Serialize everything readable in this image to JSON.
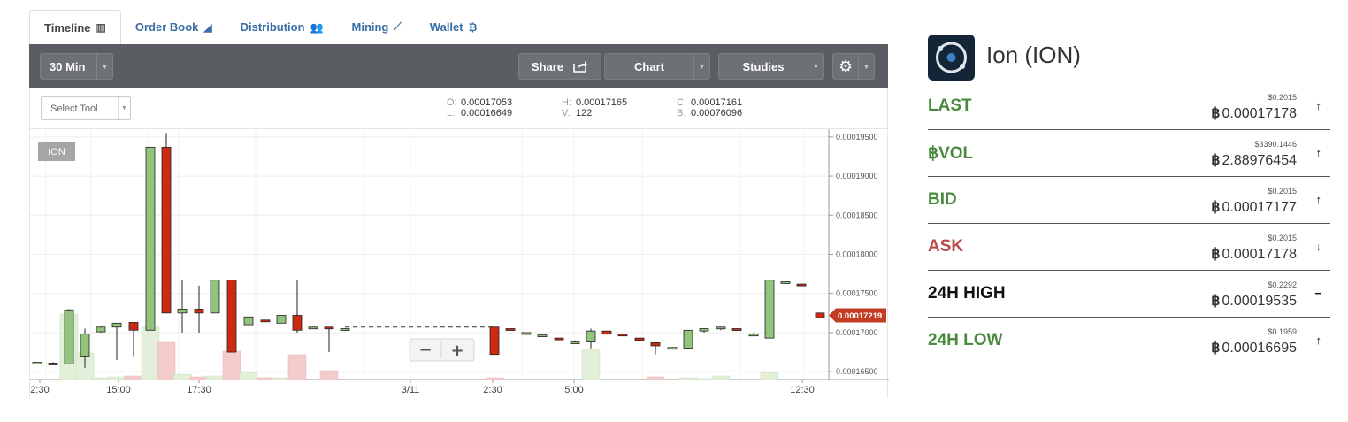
{
  "tabs": [
    {
      "label": "Timeline",
      "icon": "bar-chart-icon",
      "glyph": "▥"
    },
    {
      "label": "Order Book",
      "icon": "area-chart-icon",
      "glyph": "◢"
    },
    {
      "label": "Distribution",
      "icon": "users-icon",
      "glyph": "👥"
    },
    {
      "label": "Mining",
      "icon": "line-chart-icon",
      "glyph": "⟋"
    },
    {
      "label": "Wallet",
      "icon": "bitcoin-icon",
      "glyph": "₿"
    }
  ],
  "toolbar": {
    "interval": "30 Min",
    "share": "Share",
    "chart": "Chart",
    "studies": "Studies",
    "settings_icon": "⚙"
  },
  "tool_select": "Select Tool",
  "ohlc": {
    "o": "0.00017053",
    "h": "0.00017165",
    "c": "0.00017161",
    "l": "0.00016649",
    "v": "122",
    "b": "0.00076096",
    "o_key": "O:",
    "h_key": "H:",
    "c_key": "C:",
    "l_key": "L:",
    "v_key": "V:",
    "b_key": "B:"
  },
  "chart_data": {
    "type": "candlestick",
    "symbol_label": "ION",
    "current_price_label": "0.00017219",
    "y_ticks": [
      "0.00019500",
      "0.00019000",
      "0.00018500",
      "0.00018000",
      "0.00017500",
      "0.00017000",
      "0.00016500"
    ],
    "ylim": [
      0.000164,
      0.000196
    ],
    "x_ticks": [
      "2:30",
      "15:00",
      "17:30",
      "3/11",
      "2:30",
      "5:00",
      "12:30"
    ],
    "colors": {
      "up": "#93c47d",
      "down": "#cc2b12",
      "up_vol": "#e2f0d9",
      "down_vol": "#f4cccc",
      "last_price": "#c23b22"
    },
    "zoom_out": "−",
    "zoom_in": "+"
  },
  "coin": {
    "name": "Ion (ION)",
    "logo": "ion-logo"
  },
  "stats": [
    {
      "label": "LAST",
      "usd": "$0.2015",
      "btc": "0.00017178",
      "arrow": "↑",
      "color": "green",
      "arrow_color": "dark"
    },
    {
      "label": "฿VOL",
      "usd": "$3390.1446",
      "btc": "2.88976454",
      "arrow": "↑",
      "color": "green",
      "arrow_color": "dark"
    },
    {
      "label": "BID",
      "usd": "$0.2015",
      "btc": "0.00017177",
      "arrow": "↑",
      "color": "green",
      "arrow_color": "dark"
    },
    {
      "label": "ASK",
      "usd": "$0.2015",
      "btc": "0.00017178",
      "arrow": "↓",
      "color": "red",
      "arrow_color": "red"
    },
    {
      "label": "24H HIGH",
      "usd": "$0.2292",
      "btc": "0.00019535",
      "arrow": "−",
      "color": "dark",
      "arrow_color": "dark"
    },
    {
      "label": "24H LOW",
      "usd": "$0.1959",
      "btc": "0.00016695",
      "arrow": "↑",
      "color": "green",
      "arrow_color": "dark"
    }
  ],
  "btc_symbol": "฿"
}
